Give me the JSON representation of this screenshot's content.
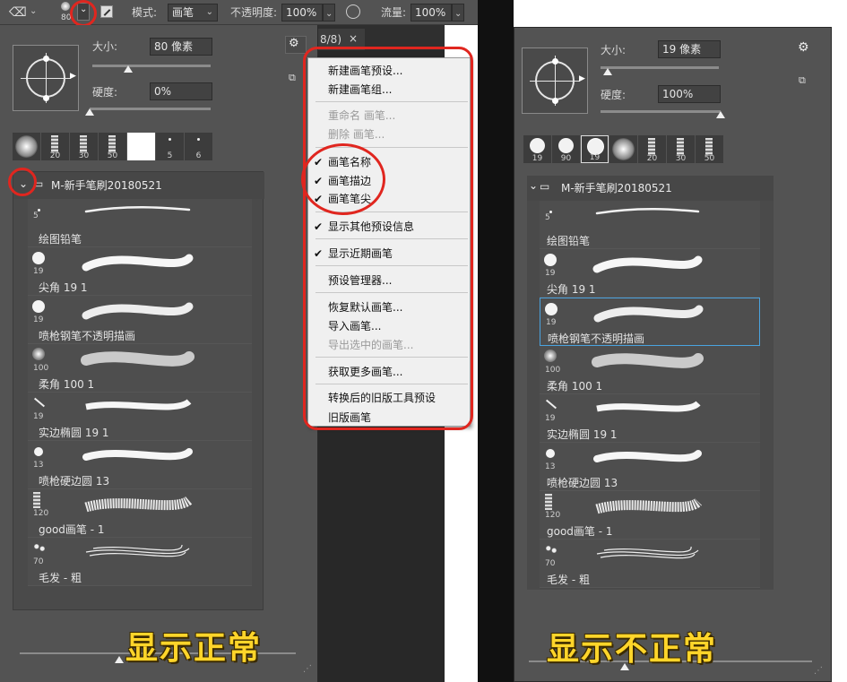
{
  "toolbar": {
    "mode_label": "模式:",
    "mode_value": "画笔",
    "opacity_label": "不透明度:",
    "opacity_value": "100%",
    "flow_label": "流量:",
    "flow_value": "100%",
    "brush_size_badge": "80"
  },
  "doc_tab": {
    "label": "8/8)",
    "close": "×"
  },
  "left_panel": {
    "size_label": "大小:",
    "size_value": "80 像素",
    "hardness_label": "硬度:",
    "hardness_value": "0%",
    "size_slider_fraction": 0.3,
    "hardness_slider_fraction": 0.0,
    "recent": [
      {
        "n": ""
      },
      {
        "n": "20"
      },
      {
        "n": "30"
      },
      {
        "n": "50"
      },
      {
        "n": ""
      },
      {
        "n": "5"
      },
      {
        "n": "6"
      }
    ],
    "group_name": "M-新手笔刷20180521",
    "brushes": [
      {
        "size": "5",
        "name": "绘图铅笔"
      },
      {
        "size": "19",
        "name": "尖角 19 1"
      },
      {
        "size": "19",
        "name": "喷枪钢笔不透明描画"
      },
      {
        "size": "100",
        "name": "柔角 100 1"
      },
      {
        "size": "19",
        "name": "实边椭圆 19 1"
      },
      {
        "size": "13",
        "name": "喷枪硬边圆 13"
      },
      {
        "size": "120",
        "name": "good画笔 - 1"
      },
      {
        "size": "70",
        "name": "毛发 - 粗"
      }
    ],
    "caption": "显示正常"
  },
  "menu": {
    "items": [
      {
        "label": "新建画笔预设...",
        "enabled": true,
        "checked": false
      },
      {
        "label": "新建画笔组...",
        "enabled": true,
        "checked": false
      },
      {
        "label": "重命名 画笔...",
        "enabled": false,
        "checked": false
      },
      {
        "label": "删除 画笔...",
        "enabled": false,
        "checked": false
      },
      {
        "label": "画笔名称",
        "enabled": true,
        "checked": true
      },
      {
        "label": "画笔描边",
        "enabled": true,
        "checked": true
      },
      {
        "label": "画笔笔尖",
        "enabled": true,
        "checked": true
      },
      {
        "label": "显示其他预设信息",
        "enabled": true,
        "checked": true
      },
      {
        "label": "显示近期画笔",
        "enabled": true,
        "checked": true
      },
      {
        "label": "预设管理器...",
        "enabled": true,
        "checked": false
      },
      {
        "label": "恢复默认画笔...",
        "enabled": true,
        "checked": false
      },
      {
        "label": "导入画笔...",
        "enabled": true,
        "checked": false
      },
      {
        "label": "导出选中的画笔...",
        "enabled": false,
        "checked": false
      },
      {
        "label": "获取更多画笔...",
        "enabled": true,
        "checked": false
      },
      {
        "label": "转换后的旧版工具预设",
        "enabled": true,
        "checked": false
      },
      {
        "label": "旧版画笔",
        "enabled": true,
        "checked": false
      }
    ]
  },
  "right_panel": {
    "size_label": "大小:",
    "size_value": "19 像素",
    "hardness_label": "硬度:",
    "hardness_value": "100%",
    "size_slider_fraction": 0.06,
    "hardness_slider_fraction": 1.0,
    "recent": [
      {
        "n": "19"
      },
      {
        "n": "90"
      },
      {
        "n": "19"
      },
      {
        "n": ""
      },
      {
        "n": "20"
      },
      {
        "n": "30"
      },
      {
        "n": "50"
      }
    ],
    "group_name": "M-新手笔刷20180521",
    "brushes": [
      {
        "size": "5",
        "name": "绘图铅笔"
      },
      {
        "size": "19",
        "name": "尖角 19 1"
      },
      {
        "size": "19",
        "name": "喷枪钢笔不透明描画"
      },
      {
        "size": "100",
        "name": "柔角 100 1"
      },
      {
        "size": "19",
        "name": "实边椭圆 19 1"
      },
      {
        "size": "13",
        "name": "喷枪硬边圆 13"
      },
      {
        "size": "120",
        "name": "good画笔 - 1"
      },
      {
        "size": "70",
        "name": "毛发 - 粗"
      }
    ],
    "selected_index": 2,
    "caption": "显示不正常"
  },
  "colors": {
    "panel_bg": "#535353",
    "annotation_red": "#e0261f",
    "caption_yellow": "#ffd52a",
    "selected_border": "#4aa3df"
  }
}
